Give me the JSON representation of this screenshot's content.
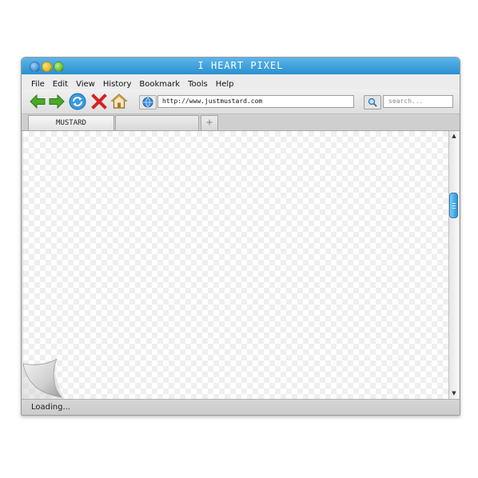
{
  "window": {
    "title": "I HEART PIXEL"
  },
  "menu": [
    "File",
    "Edit",
    "View",
    "History",
    "Bookmark",
    "Tools",
    "Help"
  ],
  "toolbar": {
    "icons": [
      "back-arrow-icon",
      "forward-arrow-icon",
      "refresh-icon",
      "stop-icon",
      "home-icon"
    ],
    "url": "http://www.justmustard.com",
    "search_placeholder": "search...",
    "colors": {
      "back": "#3f9a22",
      "forward": "#3f9a22",
      "refresh": "#2a8fd4",
      "stop": "#d42222",
      "home": "#c59a30"
    }
  },
  "tabs": {
    "items": [
      "MUSTARD",
      ""
    ],
    "add_label": "+"
  },
  "status": {
    "text": "Loading..."
  },
  "colors": {
    "titlebar": "#3aa0dd",
    "scroll_thumb": "#3aa0dd"
  }
}
